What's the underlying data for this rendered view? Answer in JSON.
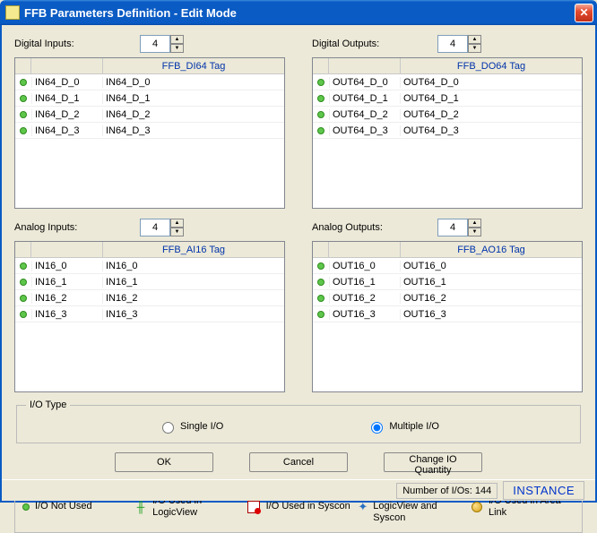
{
  "window": {
    "title": "FFB Parameters Definition - Edit Mode"
  },
  "sections": {
    "di": {
      "label": "Digital Inputs:",
      "count": "4",
      "tagHeader": "FFB_DI64 Tag",
      "rows": [
        {
          "name": "IN64_D_0",
          "tag": "IN64_D_0"
        },
        {
          "name": "IN64_D_1",
          "tag": "IN64_D_1"
        },
        {
          "name": "IN64_D_2",
          "tag": "IN64_D_2"
        },
        {
          "name": "IN64_D_3",
          "tag": "IN64_D_3"
        }
      ]
    },
    "do": {
      "label": "Digital Outputs:",
      "count": "4",
      "tagHeader": "FFB_DO64 Tag",
      "rows": [
        {
          "name": "OUT64_D_0",
          "tag": "OUT64_D_0"
        },
        {
          "name": "OUT64_D_1",
          "tag": "OUT64_D_1"
        },
        {
          "name": "OUT64_D_2",
          "tag": "OUT64_D_2"
        },
        {
          "name": "OUT64_D_3",
          "tag": "OUT64_D_3"
        }
      ]
    },
    "ai": {
      "label": "Analog Inputs:",
      "count": "4",
      "tagHeader": "FFB_AI16 Tag",
      "rows": [
        {
          "name": "IN16_0",
          "tag": "IN16_0"
        },
        {
          "name": "IN16_1",
          "tag": "IN16_1"
        },
        {
          "name": "IN16_2",
          "tag": "IN16_2"
        },
        {
          "name": "IN16_3",
          "tag": "IN16_3"
        }
      ]
    },
    "ao": {
      "label": "Analog Outputs:",
      "count": "4",
      "tagHeader": "FFB_AO16 Tag",
      "rows": [
        {
          "name": "OUT16_0",
          "tag": "OUT16_0"
        },
        {
          "name": "OUT16_1",
          "tag": "OUT16_1"
        },
        {
          "name": "OUT16_2",
          "tag": "OUT16_2"
        },
        {
          "name": "OUT16_3",
          "tag": "OUT16_3"
        }
      ]
    }
  },
  "ioType": {
    "legend": "I/O Type",
    "single": "Single I/O",
    "multiple": "Multiple I/O",
    "selected": "multiple"
  },
  "buttons": {
    "ok": "OK",
    "cancel": "Cancel",
    "change": "Change IO Quantity"
  },
  "legend": {
    "notUsed": "I/O Not Used",
    "logicView": "I/O Used in LogicView",
    "syscon": "I/O Used in Syscon",
    "both": "I/O Used in LogicView and Syscon",
    "areaLink": "I/O Used in Area Link"
  },
  "status": {
    "count": "Number of I/Os: 144",
    "mode": "INSTANCE"
  }
}
